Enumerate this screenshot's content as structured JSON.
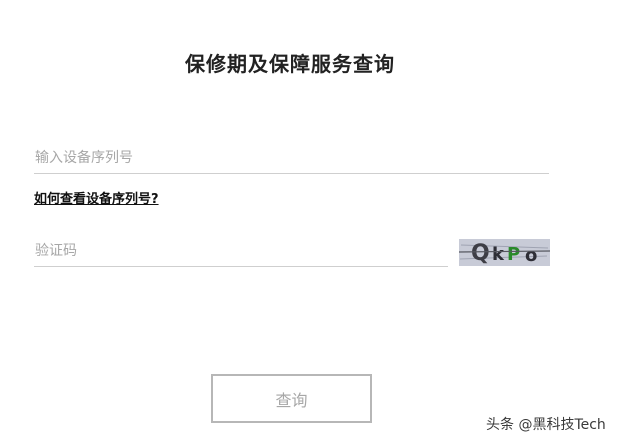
{
  "page": {
    "title": "保修期及保障服务查询"
  },
  "form": {
    "serial_placeholder": "输入设备序列号",
    "serial_value": "",
    "help_link": "如何查看设备序列号?",
    "captcha_placeholder": "验证码",
    "captcha_value": "",
    "captcha_text": "QkPo",
    "submit_label": "查询"
  },
  "watermark": {
    "text": "头条 @黑科技Tech"
  },
  "colors": {
    "text_dark": "#222222",
    "placeholder": "#a7a7a7",
    "underline": "#cfcfcf",
    "button_border": "#b7b7b7",
    "captcha_bg": "#c8cbd7",
    "captcha_green": "#2a8a2a"
  }
}
